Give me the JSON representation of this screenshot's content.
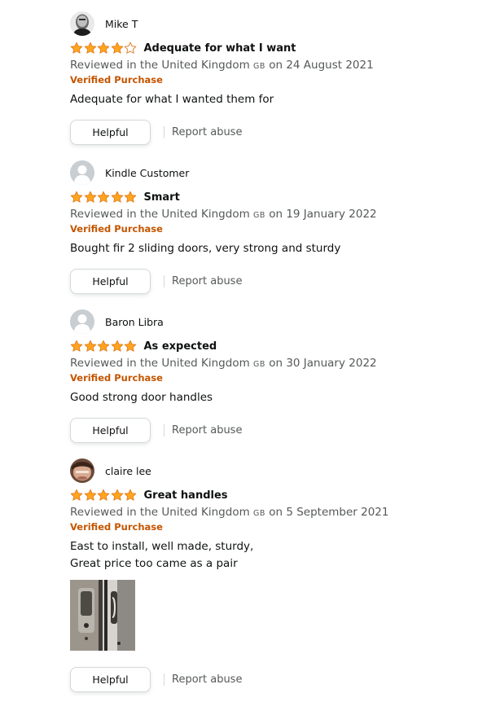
{
  "colors": {
    "star": "#ffa41c",
    "star_outline": "#de7921",
    "verified": "#c45500",
    "muted": "#565959"
  },
  "reviews": [
    {
      "reviewer": "Mike T",
      "rating": 4,
      "title": "Adequate for what I want",
      "date_prefix": "Reviewed in the United Kingdom",
      "country_code": "GB",
      "date_suffix": "on 24 August 2021",
      "verified": "Verified Purchase",
      "body": [
        "Adequate for what I wanted them for"
      ],
      "helpful": "Helpful",
      "report": "Report abuse"
    },
    {
      "reviewer": "Kindle Customer",
      "rating": 5,
      "title": "Smart",
      "date_prefix": "Reviewed in the United Kingdom",
      "country_code": "GB",
      "date_suffix": "on 19 January 2022",
      "verified": "Verified Purchase",
      "body": [
        "Bought fir 2 sliding doors, very strong and sturdy"
      ],
      "helpful": "Helpful",
      "report": "Report abuse"
    },
    {
      "reviewer": "Baron Libra",
      "rating": 5,
      "title": "As expected",
      "date_prefix": "Reviewed in the United Kingdom",
      "country_code": "GB",
      "date_suffix": "on 30 January 2022",
      "verified": "Verified Purchase",
      "body": [
        "Good strong door handles"
      ],
      "helpful": "Helpful",
      "report": "Report abuse"
    },
    {
      "reviewer": "claire lee",
      "rating": 5,
      "title": "Great handles",
      "date_prefix": "Reviewed in the United Kingdom",
      "country_code": "GB",
      "date_suffix": "on 5 September 2021",
      "verified": "Verified Purchase",
      "body": [
        "East to install, well made, sturdy,",
        "Great price too came as a pair"
      ],
      "helpful": "Helpful",
      "report": "Report abuse"
    }
  ]
}
